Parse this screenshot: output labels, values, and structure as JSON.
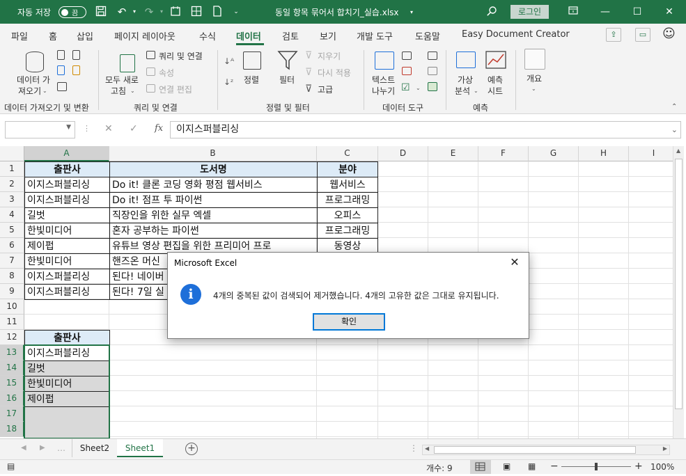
{
  "titlebar": {
    "autosave_label": "자동 저장",
    "autosave_state": "끔",
    "filename": "동일 항목 묶어서 합치기_실습.xlsx",
    "login_label": "로그인"
  },
  "tabs": [
    "파일",
    "홈",
    "삽입",
    "페이지 레이아웃",
    "수식",
    "데이터",
    "검토",
    "보기",
    "개발 도구",
    "도움말",
    "Easy Document Creator"
  ],
  "active_tab": "데이터",
  "ribbon": {
    "get_data_label_1": "데이터 가",
    "get_data_label_2": "져오기",
    "refresh_all_1": "모두 새로",
    "refresh_all_2": "고침",
    "queries_connections": "쿼리 및 연결",
    "properties": "속성",
    "edit_links": "연결 편집",
    "sort": "정렬",
    "filter": "필터",
    "clear": "지우기",
    "reapply": "다시 적용",
    "advanced": "고급",
    "text_to_columns_1": "텍스트",
    "text_to_columns_2": "나누기",
    "whatif_1": "가상",
    "whatif_2": "분석",
    "forecast_1": "예측",
    "forecast_2": "시트",
    "outline": "개요",
    "group_get_transform": "데이터 가져오기 및 변환",
    "group_queries": "쿼리 및 연결",
    "group_sort_filter": "정렬 및 필터",
    "group_data_tools": "데이터 도구",
    "group_forecast": "예측"
  },
  "formula_bar": {
    "name_box": "",
    "fx": "fx",
    "value": "이지스퍼블리싱"
  },
  "columns": [
    "A",
    "B",
    "C",
    "D",
    "E",
    "F",
    "G",
    "H",
    "I"
  ],
  "rows": [
    "1",
    "2",
    "3",
    "4",
    "5",
    "6",
    "7",
    "8",
    "9",
    "10",
    "11",
    "12",
    "13",
    "14",
    "15",
    "16",
    "17",
    "18"
  ],
  "table": {
    "headers": [
      "출판사",
      "도서명",
      "분야"
    ],
    "rows": [
      [
        "이지스퍼블리싱",
        "Do it! 클론 코딩 영화 평점 웹서비스",
        "웹서비스"
      ],
      [
        "이지스퍼블리싱",
        "Do it! 점프 투 파이썬",
        "프로그래밍"
      ],
      [
        "길벗",
        "직장인을 위한 실무 엑셀",
        "오피스"
      ],
      [
        "한빛미디어",
        "혼자 공부하는 파이썬",
        "프로그래밍"
      ],
      [
        "제이펍",
        "유튜브 영상 편집을 위한 프리미어 프로",
        "동영상"
      ],
      [
        "한빛미디어",
        "핸즈온 머신",
        ""
      ],
      [
        "이지스퍼블리싱",
        "된다! 네이버",
        ""
      ],
      [
        "이지스퍼블리싱",
        "된다! 7일 실",
        ""
      ]
    ]
  },
  "unique_table": {
    "header": "출판사",
    "values": [
      "이지스퍼블리싱",
      "길벗",
      "한빛미디어",
      "제이펍"
    ]
  },
  "sheets": [
    "Sheet2",
    "Sheet1"
  ],
  "active_sheet": "Sheet1",
  "status": {
    "count": "개수: 9",
    "zoom": "100%",
    "zoom_level": 0.5
  },
  "dialog": {
    "title": "Microsoft Excel",
    "message": "4개의 중복된 값이 검색되어 제거했습니다. 4개의 고유한 값은 그대로 유지됩니다.",
    "ok_label": "확인"
  },
  "colors": {
    "accent": "#217346",
    "header_fill": "#ddebf7",
    "selection_fill": "#d9d9d9",
    "info_blue": "#1e6fd9"
  }
}
